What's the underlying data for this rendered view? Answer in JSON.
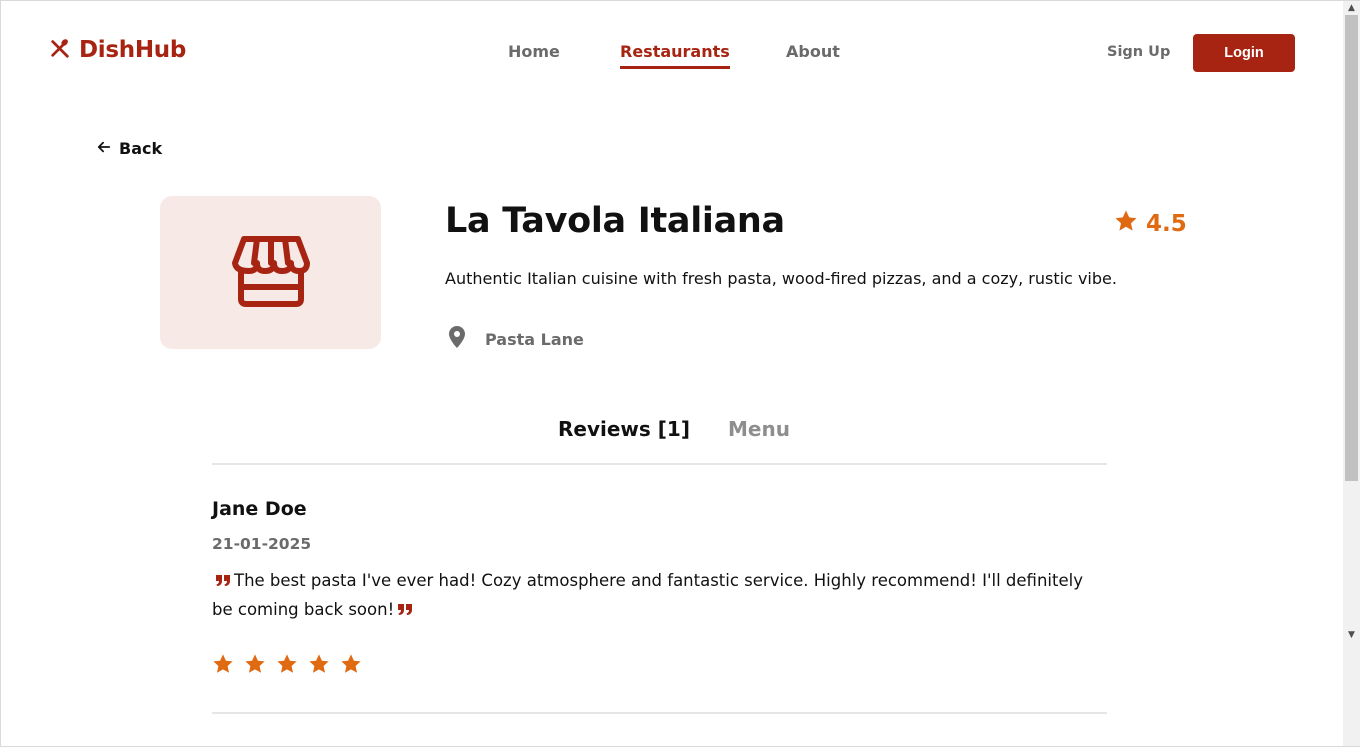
{
  "header": {
    "logo_text": "DishHub",
    "nav": [
      {
        "label": "Home"
      },
      {
        "label": "Restaurants"
      },
      {
        "label": "About"
      }
    ],
    "signup_label": "Sign Up",
    "login_label": "Login"
  },
  "back_label": "Back",
  "restaurant": {
    "name": "La Tavola Italiana",
    "rating": "4.5",
    "description": "Authentic Italian cuisine with fresh pasta, wood-fired pizzas, and a cozy, rustic vibe.",
    "location": "Pasta Lane"
  },
  "tabs": [
    {
      "label": "Reviews [1]"
    },
    {
      "label": "Menu"
    }
  ],
  "reviews": [
    {
      "name": "Jane Doe",
      "date": "21-01-2025",
      "text": "The best pasta I've ever had! Cozy atmosphere and fantastic service. Highly recommend! I'll definitely be coming back soon!",
      "stars": 5
    }
  ],
  "colors": {
    "brand": "#a82412",
    "rating": "#e06a12",
    "image_bg": "#f7e9e6"
  },
  "icons": {
    "logo": "utensils-icon",
    "back": "arrow-left-icon",
    "restaurant": "storefront-icon",
    "rating": "star-icon",
    "location": "map-pin-icon",
    "quote_open": "quote-open-icon",
    "quote_close": "quote-close-icon"
  }
}
